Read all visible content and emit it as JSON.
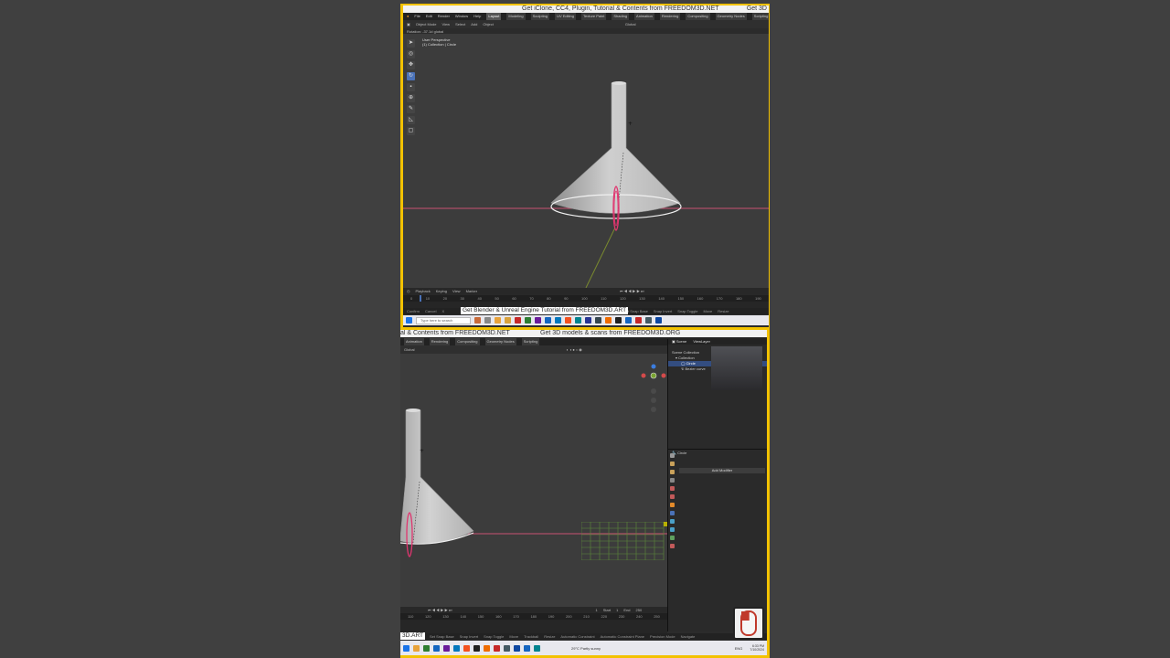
{
  "top": {
    "banner": "Get iClone, CC4, Plugin, Tutorial & Contents from FREEDOM3D.NET",
    "banner_right": "Get 3D",
    "window_title": "* (Unsaved) - Blender 4.1",
    "menus": [
      "File",
      "Edit",
      "Render",
      "Window",
      "Help"
    ],
    "workspaces": [
      "Layout",
      "Modeling",
      "Sculpting",
      "UV Editing",
      "Texture Paint",
      "Shading",
      "Animation",
      "Rendering",
      "Compositing",
      "Geometry Nodes",
      "Scripting"
    ],
    "active_workspace": "Layout",
    "header": [
      "Object Mode",
      "View",
      "Select",
      "Add",
      "Object",
      "Global"
    ],
    "operator": "Rotation: -37.1d global",
    "viewport_title": "User Perspective",
    "viewport_sub": "(1) Collection | Circle",
    "timeline_menu": [
      "Playback",
      "Keying",
      "View",
      "Marker"
    ],
    "ruler": [
      "0",
      "10",
      "20",
      "30",
      "40",
      "50",
      "60",
      "70",
      "80",
      "90",
      "100",
      "110",
      "120",
      "130",
      "140",
      "150",
      "160",
      "170",
      "180",
      "190"
    ],
    "status": [
      "Confirm",
      "Cancel",
      "X",
      "Set Snap Base",
      "Snap Invert",
      "Snap Toggle",
      "Move",
      "Resize"
    ],
    "tutorial_banner": "Get Blender & Unreal Engine Tutorial from FREEDOM3D.ART",
    "search_placeholder": "Type here to search"
  },
  "bottom": {
    "banner_left": "al & Contents from FREEDOM3D.NET",
    "banner_right": "Get 3D models & scans from FREEDOM3D.ORG",
    "menus": [
      "Animation",
      "Rendering",
      "Compositing",
      "Geometry Nodes",
      "Scripting"
    ],
    "header": [
      "Global"
    ],
    "outliner_header": "ViewLayer",
    "outliner": [
      "Scene Collection",
      "Collection",
      "Circle",
      "Bezier curve"
    ],
    "outliner_selected": "Circle",
    "scene_label": "Scene",
    "properties_object": "Circle",
    "add_modifier": "Add Modifier",
    "ruler": [
      "110",
      "120",
      "130",
      "140",
      "150",
      "160",
      "170",
      "180",
      "190",
      "200",
      "210",
      "220",
      "230",
      "240",
      "250"
    ],
    "frame_controls": [
      "1",
      "Start",
      "1",
      "End",
      "250"
    ],
    "status": [
      "Set Snap Base",
      "Snap Invert",
      "Snap Toggle",
      "Move",
      "Trackball",
      "Resize",
      "Automatic Constraint",
      "Automatic Constraint Plane",
      "Precision Mode",
      "Navigate"
    ],
    "tutorial_banner": "3D.ART",
    "weather": "29°C Partly sunny",
    "clock_time": "6:33 PM",
    "clock_date": "7/10/2024",
    "lang": "ENG"
  },
  "colors": {
    "frame": "#f3c200",
    "selection": "#334d80",
    "curve": "#e0356f",
    "axis_x": "#d44a6a"
  }
}
